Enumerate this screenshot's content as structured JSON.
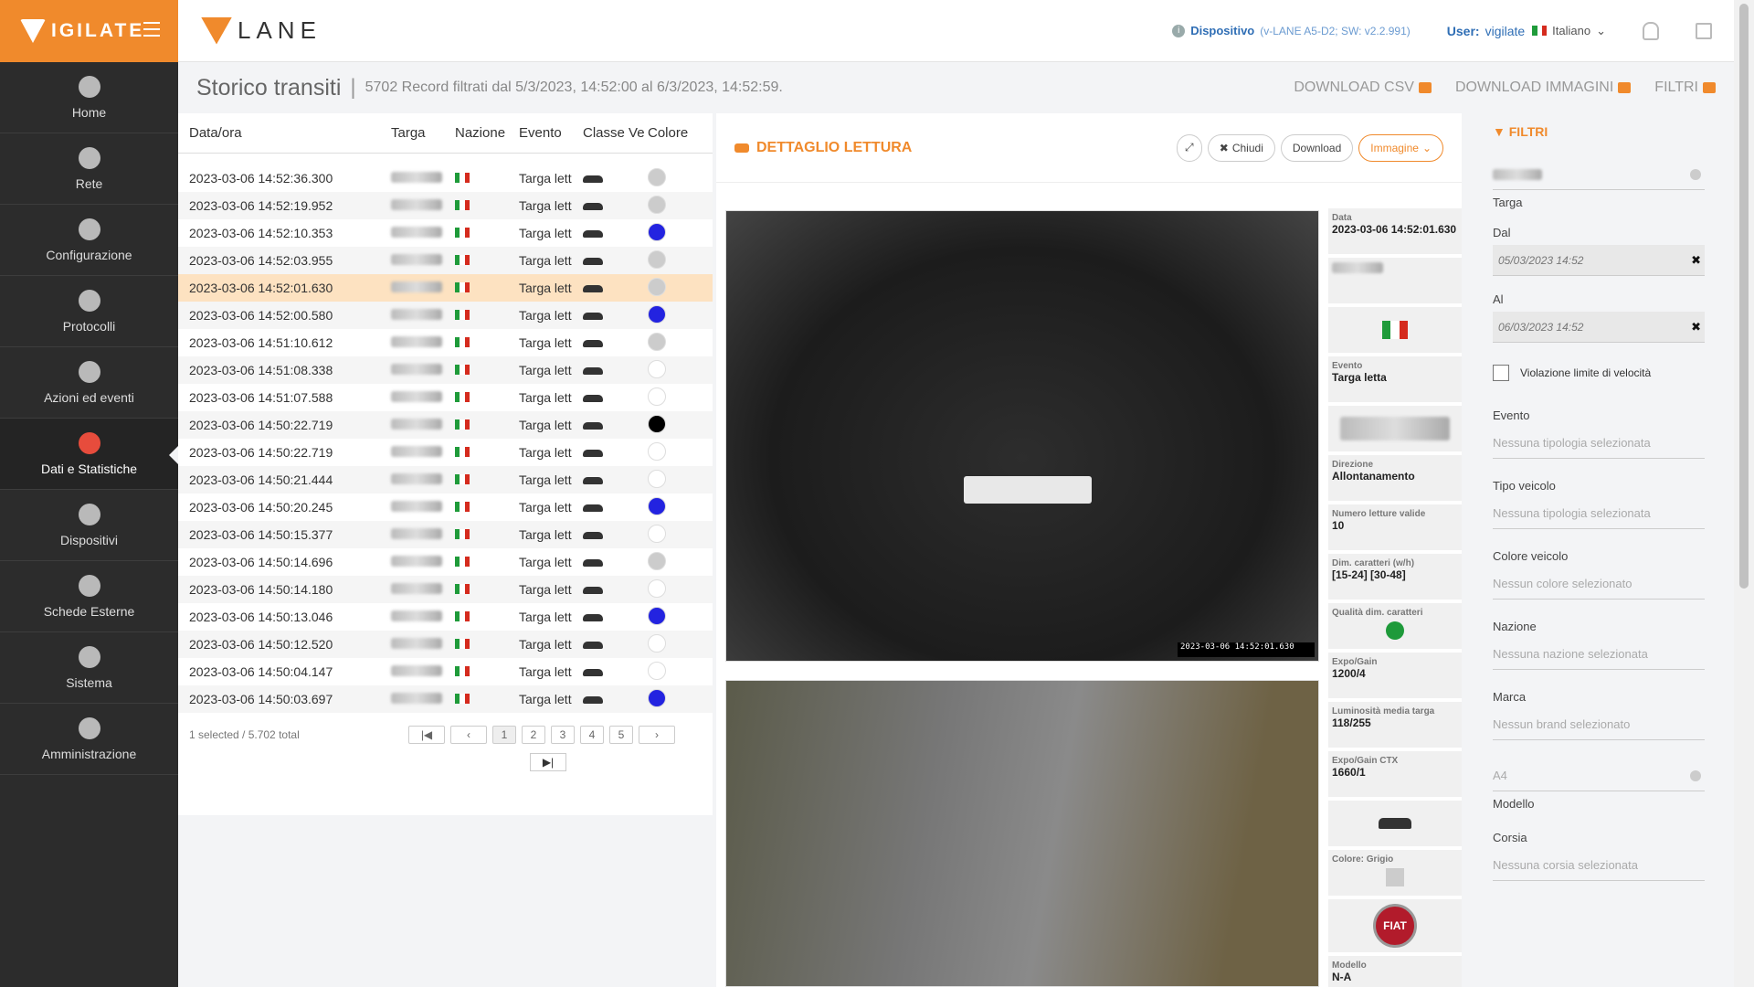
{
  "brand": {
    "name": "IGILATE"
  },
  "nav": [
    {
      "label": "Home",
      "icon": "dashboard-icon"
    },
    {
      "label": "Rete",
      "icon": "globe-icon"
    },
    {
      "label": "Configurazione",
      "icon": "gear-icon"
    },
    {
      "label": "Protocolli",
      "icon": "paper-plane-icon"
    },
    {
      "label": "Azioni ed eventi",
      "icon": "magic-wand-icon"
    },
    {
      "label": "Dati e Statistiche",
      "icon": "pie-chart-icon"
    },
    {
      "label": "Dispositivi",
      "icon": "hard-drive-icon"
    },
    {
      "label": "Schede Esterne",
      "icon": "chip-icon"
    },
    {
      "label": "Sistema",
      "icon": "cogs-icon"
    },
    {
      "label": "Amministrazione",
      "icon": "graduation-cap-icon"
    }
  ],
  "header": {
    "logo": "LANE",
    "device_label": "Dispositivo",
    "device_info": "(v-LANE A5-D2; SW: v2.2.991)",
    "user_label": "User:",
    "user_name": "vigilate",
    "language": "Italiano"
  },
  "subheader": {
    "title": "Storico transiti",
    "summary": "5702 Record filtrati dal 5/3/2023, 14:52:00 al 6/3/2023, 14:52:59.",
    "download_csv": "DOWNLOAD CSV",
    "download_images": "DOWNLOAD IMMAGINI",
    "filters": "FILTRI"
  },
  "table": {
    "headers": [
      "Data/ora",
      "Targa",
      "Nazione",
      "Evento",
      "Classe Ve",
      "Colore"
    ],
    "rows": [
      {
        "date": "2023-03-06 14:52:36.300",
        "event": "Targa lett",
        "color": "#cccccc"
      },
      {
        "date": "2023-03-06 14:52:19.952",
        "event": "Targa lett",
        "color": "#cccccc"
      },
      {
        "date": "2023-03-06 14:52:10.353",
        "event": "Targa lett",
        "color": "#2323e0"
      },
      {
        "date": "2023-03-06 14:52:03.955",
        "event": "Targa lett",
        "color": "#cccccc"
      },
      {
        "date": "2023-03-06 14:52:01.630",
        "event": "Targa lett",
        "color": "#cccccc"
      },
      {
        "date": "2023-03-06 14:52:00.580",
        "event": "Targa lett",
        "color": "#2323e0"
      },
      {
        "date": "2023-03-06 14:51:10.612",
        "event": "Targa lett",
        "color": "#cccccc"
      },
      {
        "date": "2023-03-06 14:51:08.338",
        "event": "Targa lett",
        "color": "#ffffff"
      },
      {
        "date": "2023-03-06 14:51:07.588",
        "event": "Targa lett",
        "color": "#ffffff"
      },
      {
        "date": "2023-03-06 14:50:22.719",
        "event": "Targa lett",
        "color": "#000000"
      },
      {
        "date": "2023-03-06 14:50:22.719",
        "event": "Targa lett",
        "color": "#ffffff"
      },
      {
        "date": "2023-03-06 14:50:21.444",
        "event": "Targa lett",
        "color": "#ffffff"
      },
      {
        "date": "2023-03-06 14:50:20.245",
        "event": "Targa lett",
        "color": "#2323e0"
      },
      {
        "date": "2023-03-06 14:50:15.377",
        "event": "Targa lett",
        "color": "#ffffff"
      },
      {
        "date": "2023-03-06 14:50:14.696",
        "event": "Targa lett",
        "color": "#cccccc"
      },
      {
        "date": "2023-03-06 14:50:14.180",
        "event": "Targa lett",
        "color": "#ffffff"
      },
      {
        "date": "2023-03-06 14:50:13.046",
        "event": "Targa lett",
        "color": "#2323e0"
      },
      {
        "date": "2023-03-06 14:50:12.520",
        "event": "Targa lett",
        "color": "#ffffff"
      },
      {
        "date": "2023-03-06 14:50:04.147",
        "event": "Targa lett",
        "color": "#ffffff"
      },
      {
        "date": "2023-03-06 14:50:03.697",
        "event": "Targa lett",
        "color": "#2323e0"
      }
    ],
    "footer": "1 selected / 5.702 total",
    "pages": [
      "1",
      "2",
      "3",
      "4",
      "5"
    ]
  },
  "detail": {
    "title": "DETTAGLIO LETTURA",
    "close": "Chiudi",
    "download": "Download",
    "image": "Immagine",
    "stamp": "2023-03-06 14:52:01.630",
    "meta": {
      "data_label": "Data",
      "data_value": "2023-03-06 14:52:01.630",
      "evento_label": "Evento",
      "evento_value": "Targa letta",
      "direzione_label": "Direzione",
      "direzione_value": "Allontanamento",
      "letture_label": "Numero letture valide",
      "letture_value": "10",
      "dim_label": "Dim. caratteri (w/h)",
      "dim_value": "[15-24] [30-48]",
      "qualita_label": "Qualità dim. caratteri",
      "expo_label": "Expo/Gain",
      "expo_value": "1200/4",
      "lum_label": "Luminosità media targa",
      "lum_value": "118/255",
      "ctx_label": "Expo/Gain CTX",
      "ctx_value": "1660/1",
      "colore_label": "Colore: Grigio",
      "modello_label": "Modello",
      "modello_value": "N-A",
      "brand_logo": "FIAT"
    }
  },
  "filters": {
    "title": "FILTRI",
    "targa_label": "Targa",
    "dal_label": "Dal",
    "dal_value": "05/03/2023 14:52",
    "al_label": "Al",
    "al_value": "06/03/2023 14:52",
    "speed_label": "Violazione limite di velocità",
    "evento_label": "Evento",
    "evento_ph": "Nessuna tipologia selezionata",
    "tipo_label": "Tipo veicolo",
    "tipo_ph": "Nessuna tipologia selezionata",
    "colore_label": "Colore veicolo",
    "colore_ph": "Nessun colore selezionato",
    "nazione_label": "Nazione",
    "nazione_ph": "Nessuna nazione selezionata",
    "marca_label": "Marca",
    "marca_ph": "Nessun brand selezionato",
    "modello_value": "A4",
    "modello_label": "Modello",
    "corsia_label": "Corsia",
    "corsia_ph": "Nessuna corsia selezionata"
  },
  "colors": {
    "accent": "#f08a2c",
    "sidebar": "#2c2c2c",
    "selected_row": "#fde2c1"
  }
}
